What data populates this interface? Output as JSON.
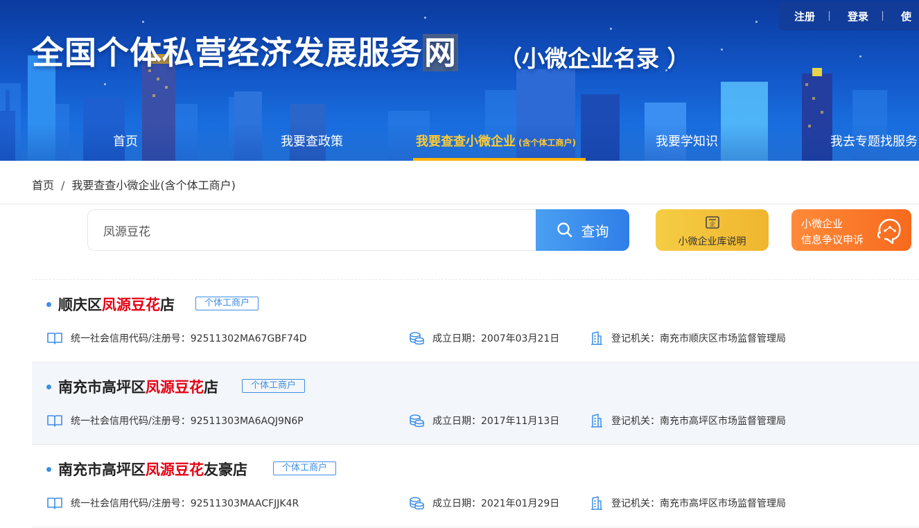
{
  "header": {
    "title_main": "全国个体私营经济发展服务",
    "title_highlight": "网",
    "subtitle": "（小微企业名录 ）",
    "userbar": {
      "register": "注册",
      "login": "登录",
      "more": "使"
    }
  },
  "nav": {
    "items": [
      {
        "label": "首页"
      },
      {
        "label": "我要查政策"
      },
      {
        "label": "我要查查小微企业",
        "small": "(含个体工商户)",
        "active": true
      },
      {
        "label": "我要学知识"
      },
      {
        "label": "我去专题找服务"
      }
    ]
  },
  "breadcrumb": {
    "home": "首页",
    "divider": "/",
    "current": "我要查查小微企业(含个体工商户)"
  },
  "search": {
    "value": "凤源豆花",
    "button_label": "查询"
  },
  "actions": {
    "explain_label": "小微企业库说明",
    "complain_line1": "小微企业",
    "complain_line2": "信息争议申诉"
  },
  "results": [
    {
      "name_prefix": "顺庆区",
      "name_keyword": "凤源豆花",
      "name_suffix": "店",
      "tag": "个体工商户",
      "credit": "统一社会信用代码/注册号：92511302MA67GBF74D",
      "date": "成立日期：2007年03月21日",
      "authority": "登记机关：南充市顺庆区市场监督管理局"
    },
    {
      "name_prefix": "南充市高坪区",
      "name_keyword": "凤源豆花",
      "name_suffix": "店",
      "tag": "个体工商户",
      "credit": "统一社会信用代码/注册号：92511303MA6AQJ9N6P",
      "date": "成立日期：2017年11月13日",
      "authority": "登记机关：南充市高坪区市场监督管理局"
    },
    {
      "name_prefix": "南充市高坪区",
      "name_keyword": "凤源豆花",
      "name_suffix": "友豪店",
      "tag": "个体工商户",
      "credit": "统一社会信用代码/注册号：92511303MAACFJJK4R",
      "date": "成立日期：2021年01月29日",
      "authority": "登记机关：南充市高坪区市场监督管理局"
    }
  ],
  "colors": {
    "accent": "#3c8ee6",
    "keyword": "#e60012",
    "nav_active": "#ffcc33",
    "explain_btn": "#f2c23a",
    "complain_btn": "#f7741f"
  }
}
